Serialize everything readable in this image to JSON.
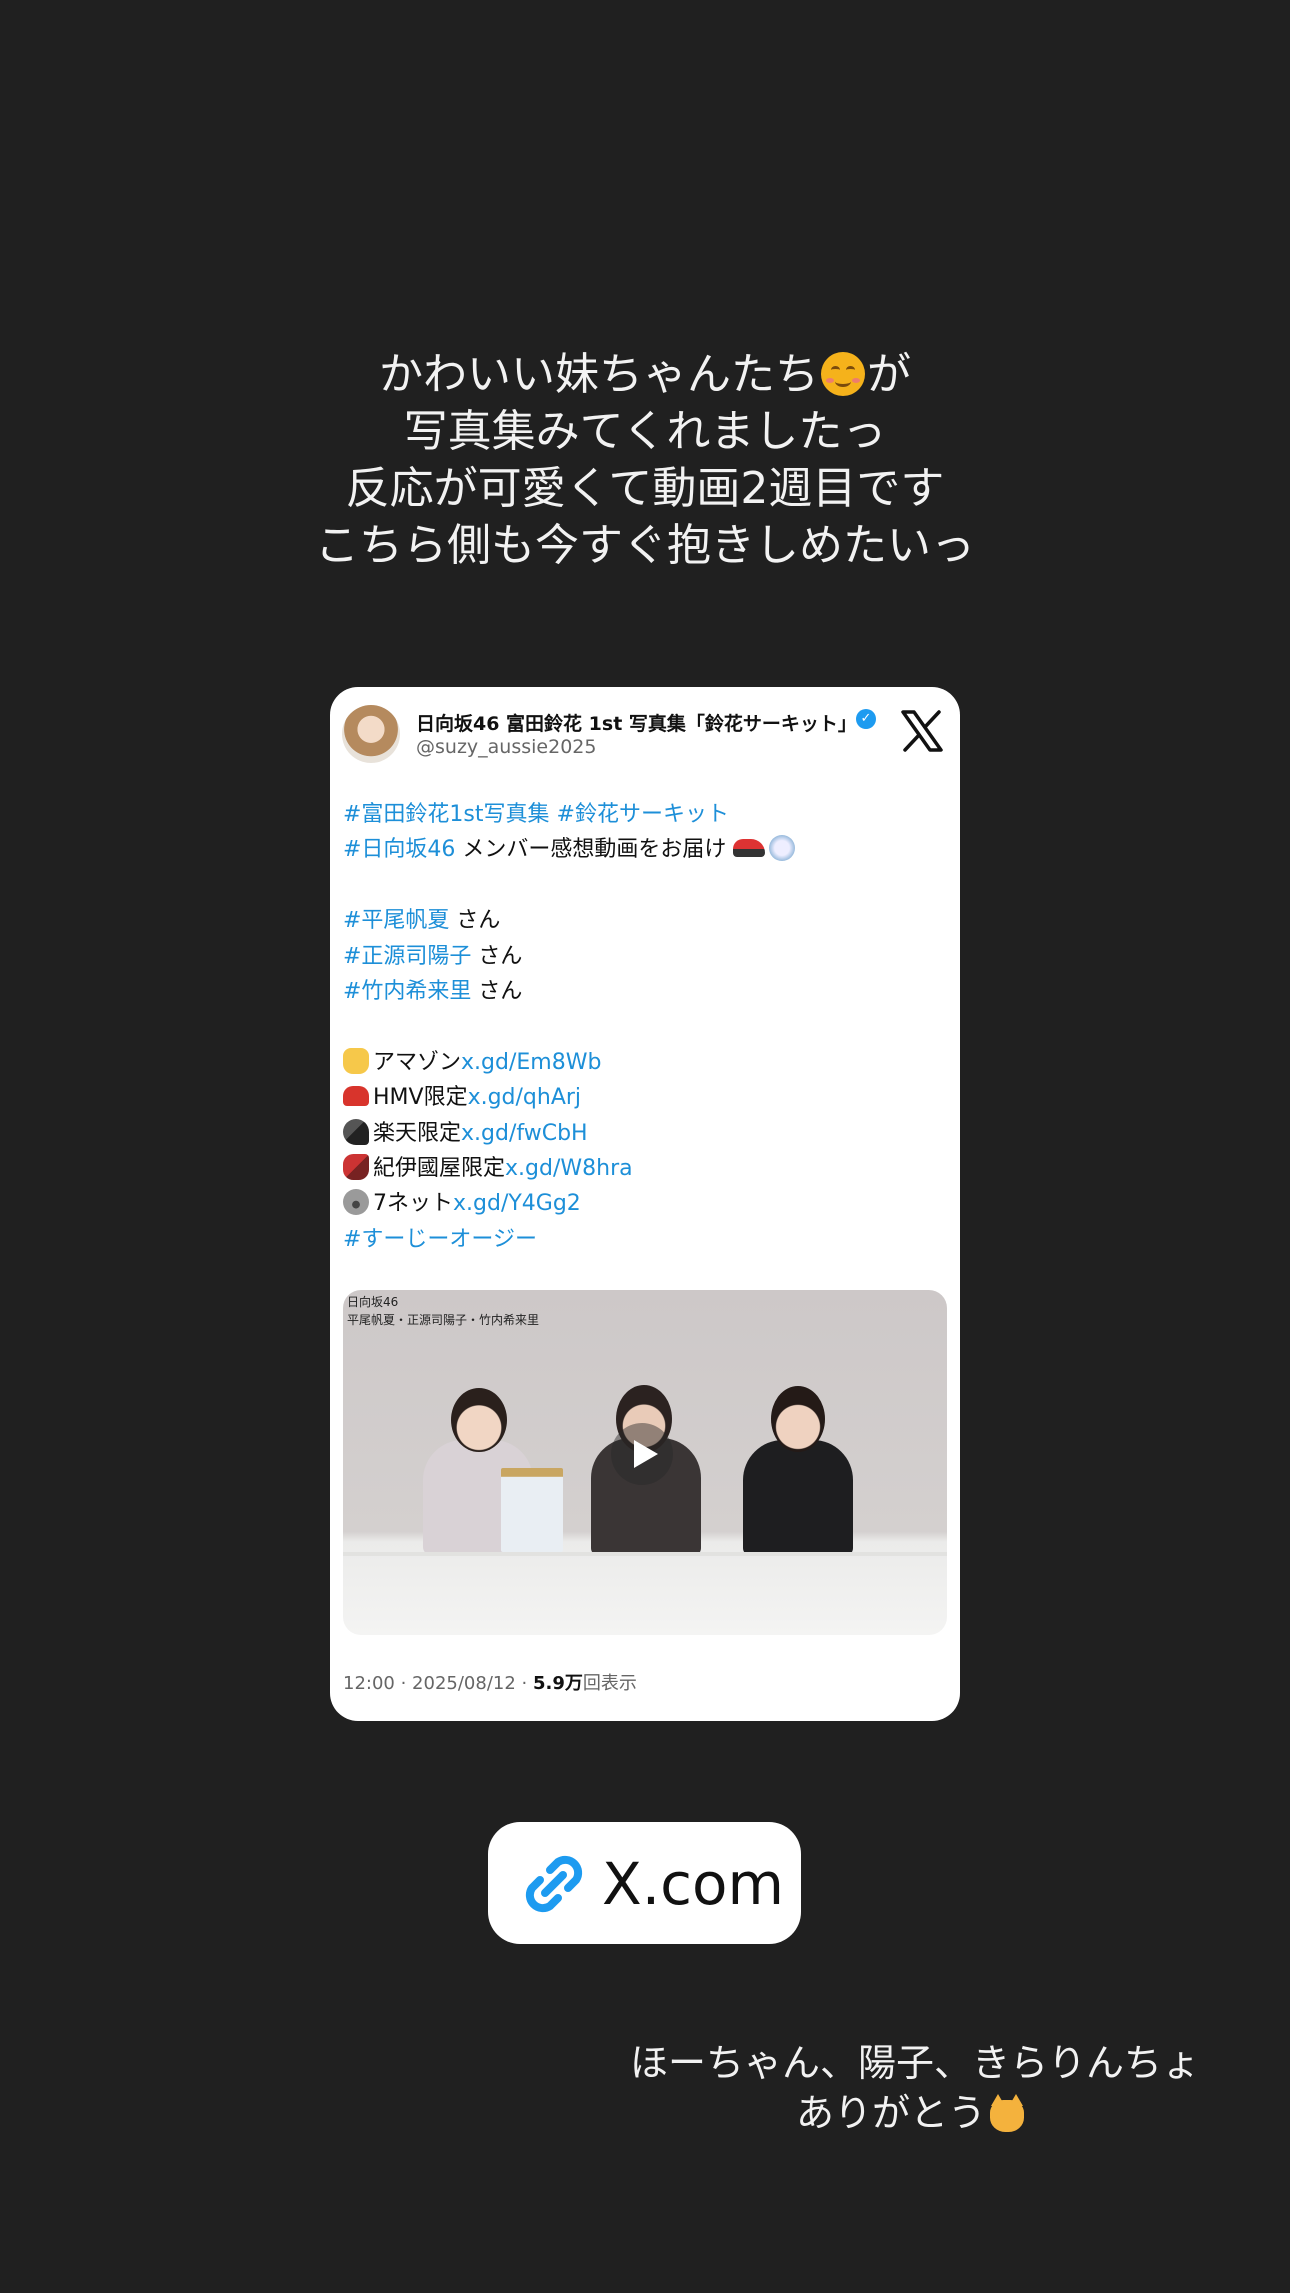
{
  "story": {
    "caption_top": [
      {
        "text": "かわいい妹ちゃんたち",
        "emoji": "smiling-face",
        "tail": "が"
      },
      {
        "text": "写真集みてくれましたっ"
      },
      {
        "text": "反応が可愛くて動画2週目です"
      },
      {
        "text": "こちら側も今すぐ抱きしめたいっ"
      }
    ],
    "caption_bottom": [
      "ほーちゃん、陽子、きらりんちょ",
      "ありがとう"
    ],
    "caption_bottom_emoji": "cat-face"
  },
  "tweet": {
    "name": "日向坂46 富田鈴花 1st 写真集「鈴花サーキット」...",
    "handle": "@suzy_aussie2025",
    "verified_icon": "verified-badge",
    "logo": "x-logo",
    "lines": [
      {
        "tag1": "#富田鈴花1st写真集",
        "sep": " ",
        "tag2": "#鈴花サーキット"
      },
      {
        "tag": "#日向坂46",
        "text": " メンバー感想動画をお届け"
      },
      {
        "tag": "#平尾帆夏",
        "text": " さん"
      },
      {
        "tag": "#正源司陽子",
        "text": " さん"
      },
      {
        "tag": "#竹内希来里",
        "text": " さん"
      },
      {
        "text": "アマゾン",
        "link": "x.gd/Em8Wb",
        "icon": "victory-hand-icon"
      },
      {
        "text": "HMV限定",
        "link": "x.gd/qhArj",
        "icon": "car-icon"
      },
      {
        "text": "楽天限定",
        "link": "x.gd/fwCbH",
        "icon": "microphone-icon"
      },
      {
        "text": "紀伊國屋限定",
        "link": "x.gd/W8hra",
        "icon": "guitar-icon"
      },
      {
        "text": "7ネット",
        "link": "x.gd/Y4Gg2",
        "icon": "koala-icon"
      },
      {
        "tag": "#すーじーオージー"
      }
    ],
    "video": {
      "overlay_line1": "日向坂46",
      "overlay_line2": "平尾帆夏・正源司陽子・竹内希来里"
    },
    "meta_time": "12:00 · 2025/08/12 · ",
    "meta_views": "5.9万",
    "meta_views_suffix": "回表示"
  },
  "link_sticker": {
    "label": "X.com",
    "icon": "link-icon"
  },
  "colors": {
    "background": "#202020",
    "hashtag": "#1d8fd8",
    "link_icon": "#1d9bf0"
  }
}
